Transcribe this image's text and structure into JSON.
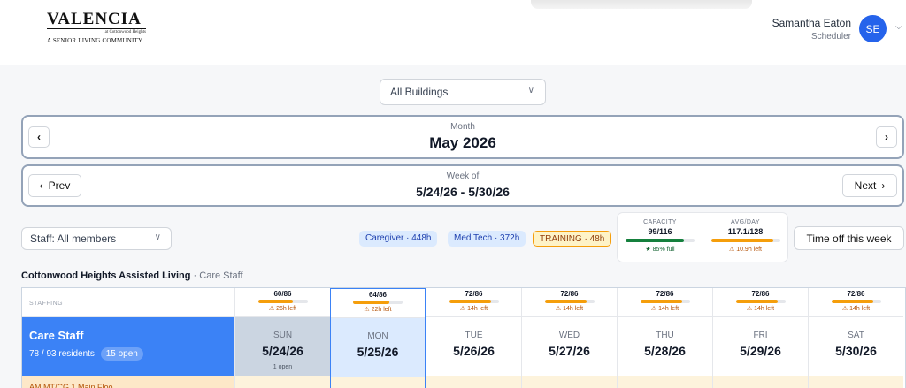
{
  "header": {
    "logo_main": "VALENCIA",
    "logo_sub": "at Cottonwood Heights",
    "logo_tag": "A SENIOR LIVING COMMUNITY",
    "user_name": "Samantha Eaton",
    "user_role": "Scheduler",
    "avatar_initials": "SE"
  },
  "building_filter": {
    "selected": "All Buildings"
  },
  "month_nav": {
    "caption": "Month",
    "title": "May 2026"
  },
  "week_nav": {
    "caption": "Week of",
    "title": "5/24/26 - 5/30/26",
    "prev_label": "Prev",
    "next_label": "Next"
  },
  "staff_filter": {
    "selected": "Staff: All members"
  },
  "role_pills": [
    {
      "label": "Caregiver · 448h"
    },
    {
      "label": "Med Tech · 372h"
    },
    {
      "label": "TRAINING · 48h"
    }
  ],
  "capacity": {
    "label": "CAPACITY",
    "value": "99/116",
    "fraction": 0.85,
    "note": "85% full"
  },
  "avg_day": {
    "label": "AVG/DAY",
    "value": "117.1/128",
    "fraction": 0.91,
    "note": "10.9h left"
  },
  "timeoff_button": "Time off this week",
  "section": {
    "title": "Cottonwood Heights Assisted Living",
    "subtitle": " · Care Staff"
  },
  "grid": {
    "staffing_label": "STAFFING",
    "row": {
      "title": "Care Staff",
      "residents": "78 / 93 residents",
      "open": "15 open",
      "next_row_text": "AM MT/CG 1 Main Floo"
    },
    "days": [
      {
        "ratio": "60/86",
        "fill": 0.7,
        "left": "26h left",
        "name": "SUN",
        "date": "5/24/26",
        "open": "1 open"
      },
      {
        "ratio": "64/86",
        "fill": 0.74,
        "left": "22h left",
        "name": "MON",
        "date": "5/25/26",
        "open": ""
      },
      {
        "ratio": "72/86",
        "fill": 0.84,
        "left": "14h left",
        "name": "TUE",
        "date": "5/26/26",
        "open": ""
      },
      {
        "ratio": "72/86",
        "fill": 0.84,
        "left": "14h left",
        "name": "WED",
        "date": "5/27/26",
        "open": ""
      },
      {
        "ratio": "72/86",
        "fill": 0.84,
        "left": "14h left",
        "name": "THU",
        "date": "5/28/26",
        "open": ""
      },
      {
        "ratio": "72/86",
        "fill": 0.84,
        "left": "14h left",
        "name": "FRI",
        "date": "5/29/26",
        "open": ""
      },
      {
        "ratio": "72/86",
        "fill": 0.84,
        "left": "14h left",
        "name": "SAT",
        "date": "5/30/26",
        "open": ""
      }
    ]
  },
  "colors": {
    "accent": "#3b82f6",
    "warning": "#f59e0b",
    "success": "#16a34a"
  }
}
